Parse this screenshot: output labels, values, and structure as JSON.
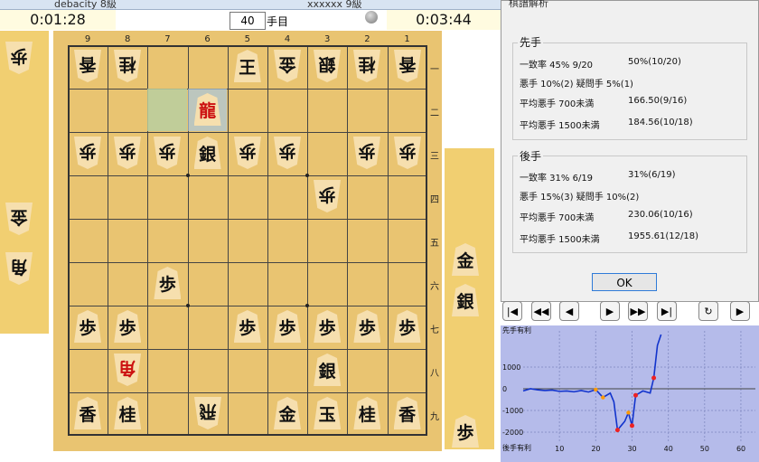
{
  "players": {
    "sente_name": "debacity 8級",
    "gote_name": "xxxxxx 9級"
  },
  "timers": {
    "left": "0:01:28",
    "right": "0:03:44"
  },
  "move": {
    "number": "40",
    "label": "手目"
  },
  "board": {
    "files": [
      "9",
      "8",
      "7",
      "6",
      "5",
      "4",
      "3",
      "2",
      "1"
    ],
    "ranks": [
      "一",
      "二",
      "三",
      "四",
      "五",
      "六",
      "七",
      "八",
      "九"
    ],
    "pieces": [
      {
        "glyph": "香",
        "file": 9,
        "rank": 1,
        "side": "gote"
      },
      {
        "glyph": "桂",
        "file": 8,
        "rank": 1,
        "side": "gote"
      },
      {
        "glyph": "王",
        "file": 5,
        "rank": 1,
        "side": "sente"
      },
      {
        "glyph": "金",
        "file": 4,
        "rank": 1,
        "side": "gote"
      },
      {
        "glyph": "銀",
        "file": 3,
        "rank": 1,
        "side": "gote"
      },
      {
        "glyph": "桂",
        "file": 2,
        "rank": 1,
        "side": "gote"
      },
      {
        "glyph": "香",
        "file": 1,
        "rank": 1,
        "side": "gote"
      },
      {
        "glyph": "龍",
        "file": 6,
        "rank": 2,
        "side": "sente",
        "promoted": true
      },
      {
        "glyph": "歩",
        "file": 9,
        "rank": 3,
        "side": "gote"
      },
      {
        "glyph": "歩",
        "file": 8,
        "rank": 3,
        "side": "gote"
      },
      {
        "glyph": "歩",
        "file": 7,
        "rank": 3,
        "side": "gote"
      },
      {
        "glyph": "銀",
        "file": 6,
        "rank": 3,
        "side": "sente"
      },
      {
        "glyph": "歩",
        "file": 5,
        "rank": 3,
        "side": "gote"
      },
      {
        "glyph": "歩",
        "file": 4,
        "rank": 3,
        "side": "gote"
      },
      {
        "glyph": "歩",
        "file": 2,
        "rank": 3,
        "side": "gote"
      },
      {
        "glyph": "歩",
        "file": 1,
        "rank": 3,
        "side": "gote"
      },
      {
        "glyph": "歩",
        "file": 3,
        "rank": 4,
        "side": "gote"
      },
      {
        "glyph": "歩",
        "file": 7,
        "rank": 6,
        "side": "sente"
      },
      {
        "glyph": "歩",
        "file": 9,
        "rank": 7,
        "side": "sente"
      },
      {
        "glyph": "歩",
        "file": 8,
        "rank": 7,
        "side": "sente"
      },
      {
        "glyph": "歩",
        "file": 5,
        "rank": 7,
        "side": "sente"
      },
      {
        "glyph": "歩",
        "file": 4,
        "rank": 7,
        "side": "sente"
      },
      {
        "glyph": "歩",
        "file": 3,
        "rank": 7,
        "side": "sente"
      },
      {
        "glyph": "歩",
        "file": 2,
        "rank": 7,
        "side": "sente"
      },
      {
        "glyph": "歩",
        "file": 1,
        "rank": 7,
        "side": "sente"
      },
      {
        "glyph": "角",
        "file": 8,
        "rank": 8,
        "side": "gote",
        "promoted": true
      },
      {
        "glyph": "銀",
        "file": 3,
        "rank": 8,
        "side": "sente"
      },
      {
        "glyph": "香",
        "file": 9,
        "rank": 9,
        "side": "sente"
      },
      {
        "glyph": "桂",
        "file": 8,
        "rank": 9,
        "side": "sente"
      },
      {
        "glyph": "飛",
        "file": 6,
        "rank": 9,
        "side": "gote"
      },
      {
        "glyph": "金",
        "file": 4,
        "rank": 9,
        "side": "sente"
      },
      {
        "glyph": "玉",
        "file": 3,
        "rank": 9,
        "side": "sente"
      },
      {
        "glyph": "桂",
        "file": 2,
        "rank": 9,
        "side": "sente"
      },
      {
        "glyph": "香",
        "file": 1,
        "rank": 9,
        "side": "sente"
      }
    ],
    "last_move_from": {
      "file": 7,
      "rank": 2
    },
    "last_move_to": {
      "file": 6,
      "rank": 2
    }
  },
  "hands": {
    "gote": [
      "歩",
      "金",
      "角"
    ],
    "sente": [
      "金",
      "銀",
      "歩"
    ]
  },
  "dialog": {
    "title": "棋譜解析",
    "sente": {
      "heading": "先手",
      "rows": [
        {
          "label": "一致率 45% 9/20",
          "value": "50%(10/20)"
        },
        {
          "label": "悪手 10%(2) 疑問手 5%(1)",
          "value": ""
        },
        {
          "label": "平均悪手 700未満",
          "value": "166.50(9/16)"
        },
        {
          "label": "平均悪手 1500未満",
          "value": "184.56(10/18)"
        }
      ]
    },
    "gote": {
      "heading": "後手",
      "rows": [
        {
          "label": "一致率 31% 6/19",
          "value": "31%(6/19)"
        },
        {
          "label": "悪手 15%(3) 疑問手 10%(2)",
          "value": ""
        },
        {
          "label": "平均悪手 700未満",
          "value": "230.06(10/16)"
        },
        {
          "label": "平均悪手 1500未満",
          "value": "1955.61(12/18)"
        }
      ]
    },
    "ok_label": "OK"
  },
  "nav_buttons": [
    "|◀",
    "◀◀",
    "◀",
    "▶",
    "▶▶",
    "▶|",
    "↻",
    "▶"
  ],
  "chart_data": {
    "type": "line",
    "top_label": "先手有利",
    "bottom_label": "後手有利",
    "y_ticks": [
      "1000",
      "0",
      "-1000",
      "-2000"
    ],
    "x_ticks": [
      "10",
      "20",
      "30",
      "40",
      "50",
      "60"
    ],
    "series": [
      {
        "values": [
          [
            0,
            -100
          ],
          [
            2,
            0
          ],
          [
            4,
            -50
          ],
          [
            6,
            -80
          ],
          [
            8,
            -60
          ],
          [
            10,
            -120
          ],
          [
            12,
            -100
          ],
          [
            14,
            -140
          ],
          [
            16,
            -80
          ],
          [
            18,
            -150
          ],
          [
            20,
            -40
          ],
          [
            22,
            -400
          ],
          [
            24,
            -200
          ],
          [
            25,
            -600
          ],
          [
            26,
            -1900
          ],
          [
            27,
            -1700
          ],
          [
            28,
            -1500
          ],
          [
            29,
            -1100
          ],
          [
            30,
            -1700
          ],
          [
            31,
            -300
          ],
          [
            33,
            -100
          ],
          [
            35,
            -200
          ],
          [
            36,
            500
          ],
          [
            37,
            2000
          ],
          [
            38,
            6000
          ]
        ]
      }
    ],
    "colors": {
      "line": "#1133cc",
      "marker_bad": "#ee2222",
      "marker_dubious": "#ff9900"
    }
  }
}
